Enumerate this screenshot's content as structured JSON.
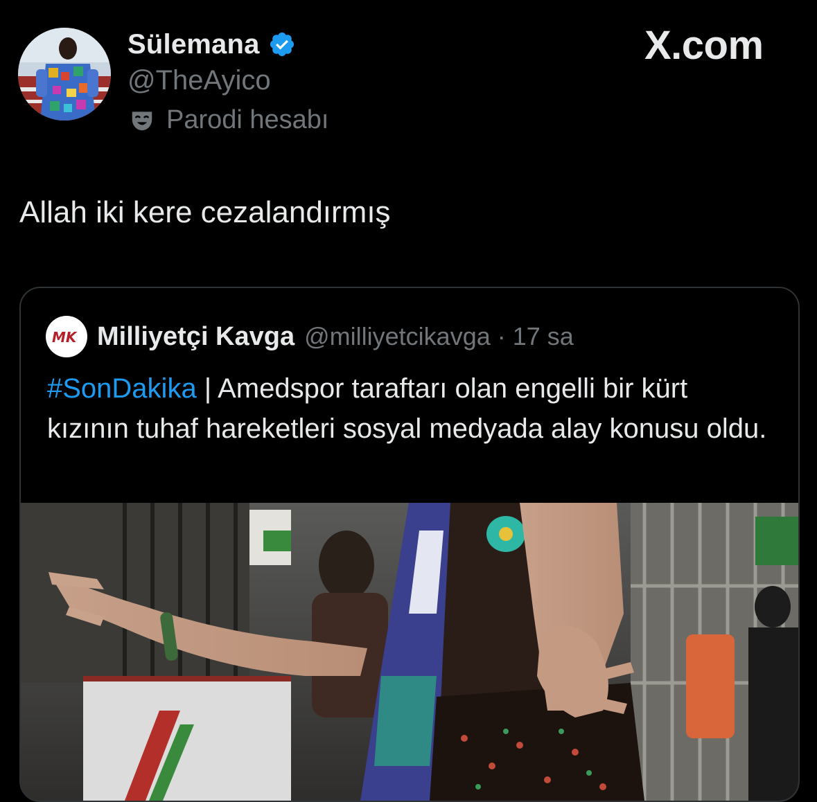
{
  "author": {
    "display_name": "Sülemana",
    "handle": "@TheAyico",
    "label": "Parodi hesabı",
    "verified_color": "#1d9bf0"
  },
  "watermark": "X.com",
  "tweet": {
    "text": "Allah iki kere cezalandırmış"
  },
  "quoted": {
    "name": "Milliyetçi Kavga",
    "handle": "@milliyetcikavga",
    "separator": "·",
    "time": "17 sa",
    "hashtag": "#SonDakika",
    "text": " | Amedspor taraftarı olan engelli bir kürt kızının tuhaf hareketleri sosyal medyada alay konusu oldu."
  },
  "colors": {
    "background": "#000000",
    "text_primary": "#e7e9ea",
    "text_secondary": "#71767b",
    "link": "#1d9bf0",
    "border": "#2f3336"
  },
  "icons": {
    "verified": "verified-badge-icon",
    "parody": "theater-mask-icon",
    "logo": "x-logo-icon"
  }
}
